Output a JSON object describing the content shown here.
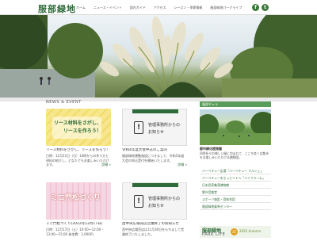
{
  "header": {
    "logo": "服部緑地",
    "nav": [
      "ホーム",
      "ニュース・イベント",
      "園内ガイド",
      "アクセス",
      "シーズン・季節情報",
      "服部緑地パークライフ"
    ],
    "social": [
      "f",
      "t"
    ]
  },
  "news": {
    "section_title": "NEWS & EVENT",
    "cards": [
      {
        "img_text1": "リース材料をさがし、",
        "img_text2": "リースを作ろう！",
        "tag": "",
        "title": "リース材料をさがし、リースを作ろう！",
        "body": "日時：12月11日（日）10時からの作り方と材料の紹介し、どなたでもお楽しみいただけます。",
        "more": "詳細 »"
      },
      {
        "notice_t1": "管理事務所からの",
        "notice_t2": "お知らせ",
        "title": "令和4年度大会申込のご案内",
        "body": "服部緑地運動施設につきまして、令和5年度大会の申込受付を開始いたします。",
        "more": "詳細 »"
      },
      {
        "img_text1": "ミニ門松づくり",
        "tag": "",
        "title": "ミニ門松づくり(2022年12月17日)",
        "body": "日時：12月17日（土）10:00〜12:00・13:00〜15:00 参加費：1,000円",
        "more": ""
      },
      {
        "notice_t1": "管理事務所からの",
        "notice_t2": "お知らせ",
        "title": "西中央広場売店営業終了のお知らせ",
        "body": "西中央広場売店は11月30日をもちまして営業終了いたしました。",
        "more": ""
      }
    ]
  },
  "sidebar": {
    "head": "服部ギャラ",
    "caption": "都市緑化植物園",
    "text": "四季折々の美しい緑に包まれて、ここち良くお散歩をお楽しみいただける植物園。",
    "links": [
      "バーベキュー広場「バーベキュー マルシェ」",
      "バーベキューをもっとソトへ「メイフラーム」",
      "日本民家集落博物館",
      "野外音楽堂",
      "スポーツ施設・団体利用",
      "服部緑地乗馬センター"
    ],
    "banner": {
      "b1": "服部緑地",
      "b2": "PARK LIFE",
      "badge": "35",
      "b3": "2022 Autumn"
    }
  },
  "colors": {
    "brand": "#2e6a3a",
    "accent": "#5a9c5a"
  }
}
